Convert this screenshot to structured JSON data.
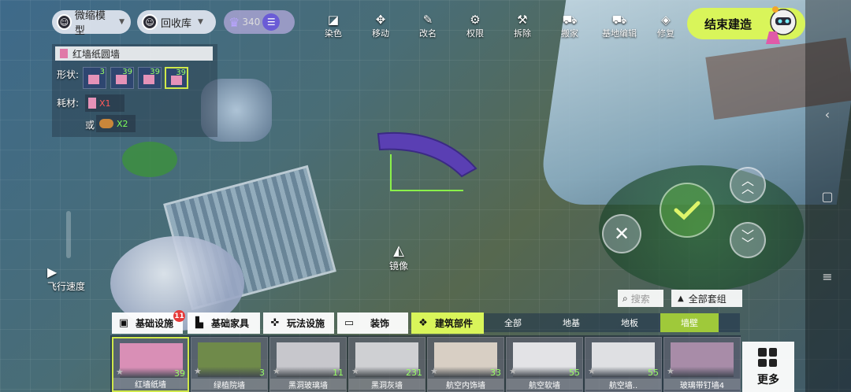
{
  "top": {
    "miniature_label": "微缩模型",
    "recycle_label": "回收库",
    "crown_count": "340",
    "tools": [
      {
        "label": "染色",
        "icon": "bucket-icon"
      },
      {
        "label": "移动",
        "icon": "move-icon"
      },
      {
        "label": "改名",
        "icon": "pencil-icon"
      },
      {
        "label": "权限",
        "icon": "gear-icon"
      },
      {
        "label": "拆除",
        "icon": "hammer-icon"
      },
      {
        "label": "搬家",
        "icon": "truck-icon"
      },
      {
        "label": "基地编辑",
        "icon": "truck-edit-icon"
      },
      {
        "label": "修复",
        "icon": "repair-icon"
      }
    ],
    "end_build_label": "结束建造"
  },
  "panel": {
    "title": "红墙纸圆墙",
    "shape_label": "形状:",
    "shape_counts": [
      "3",
      "39",
      "39",
      "39"
    ],
    "material_label": "耗材:",
    "material_1_qty": "X1",
    "or_label": "或",
    "material_2_qty": "X2"
  },
  "left": {
    "fly_speed_label": "飞行速度"
  },
  "mirror_label": "镜像",
  "search_placeholder": "搜索",
  "all_sets_label": "全部套组",
  "categories": [
    {
      "label": "基础设施",
      "icon": "box-icon",
      "badge": "11"
    },
    {
      "label": "基础家具",
      "icon": "sofa-icon"
    },
    {
      "label": "玩法设施",
      "icon": "gamepad-icon"
    },
    {
      "label": "装饰",
      "icon": "paint-roller-icon"
    },
    {
      "label": "建筑部件",
      "icon": "building-part-icon"
    }
  ],
  "subtabs": [
    "全部",
    "地基",
    "地板",
    "墙壁"
  ],
  "items": [
    {
      "name": "红墙纸墙",
      "count": "39",
      "color": "#d98fb6"
    },
    {
      "name": "绿植院墙",
      "count": "3",
      "color": "#6f8a4a"
    },
    {
      "name": "黑洞玻璃墙",
      "count": "11",
      "color": "#c7c7cc"
    },
    {
      "name": "黑洞灰墙",
      "count": "231",
      "color": "#cfd0d3"
    },
    {
      "name": "航空内饰墙",
      "count": "33",
      "color": "#d8cfc4"
    },
    {
      "name": "航空软墙",
      "count": "55",
      "color": "#e3e3e6"
    },
    {
      "name": "航空墙..",
      "count": "55",
      "color": "#dfe0e3"
    },
    {
      "name": "玻璃带钉墙4",
      "count": "",
      "color": "#a88ca8"
    }
  ],
  "more_label": "更多",
  "colors": {
    "accent": "#d9f55a",
    "selected": "#cfe84a",
    "badge": "#e53a3a"
  }
}
